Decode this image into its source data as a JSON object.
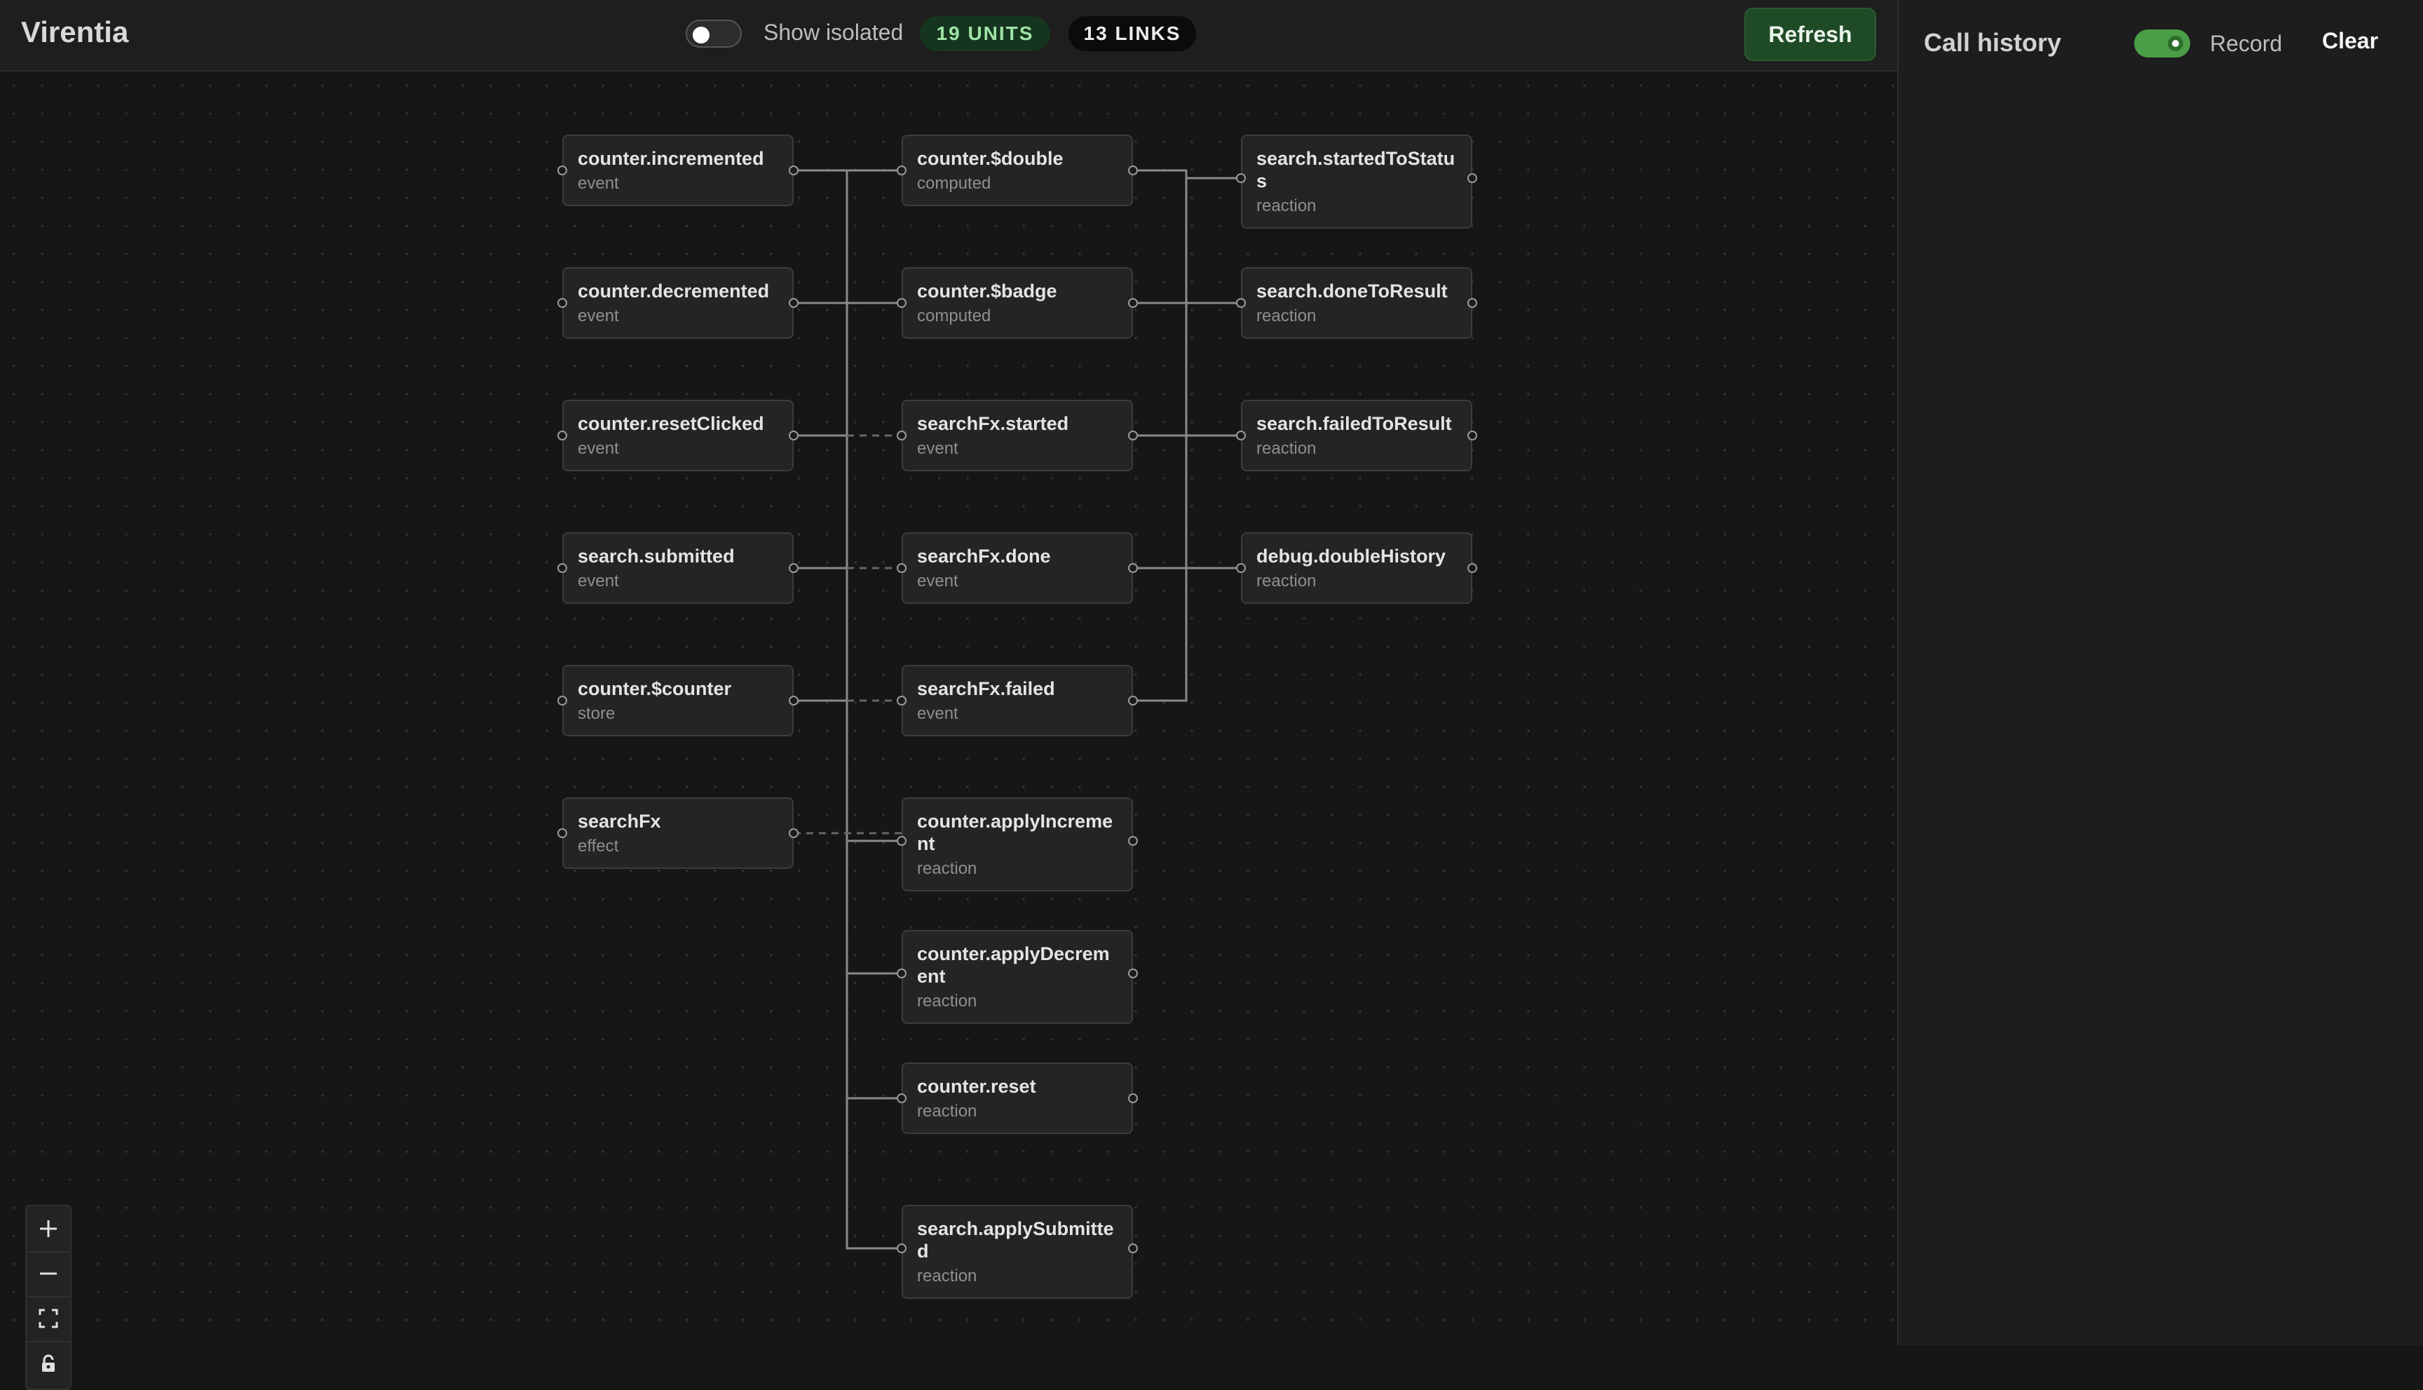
{
  "header": {
    "app_title": "Virentia",
    "show_isolated_label": "Show isolated",
    "show_isolated_on": false,
    "units_badge": "19 UNITS",
    "links_badge": "13 LINKS",
    "refresh_label": "Refresh"
  },
  "graph": {
    "nodes": [
      {
        "name": "counter.incremented",
        "type": "event"
      },
      {
        "name": "counter.decremented",
        "type": "event"
      },
      {
        "name": "counter.resetClicked",
        "type": "event"
      },
      {
        "name": "search.submitted",
        "type": "event"
      },
      {
        "name": "counter.$counter",
        "type": "store"
      },
      {
        "name": "searchFx",
        "type": "effect"
      },
      {
        "name": "counter.$double",
        "type": "computed"
      },
      {
        "name": "counter.$badge",
        "type": "computed"
      },
      {
        "name": "searchFx.started",
        "type": "event"
      },
      {
        "name": "searchFx.done",
        "type": "event"
      },
      {
        "name": "searchFx.failed",
        "type": "event"
      },
      {
        "name": "counter.applyIncrement",
        "type": "reaction"
      },
      {
        "name": "counter.applyDecrement",
        "type": "reaction"
      },
      {
        "name": "counter.reset",
        "type": "reaction"
      },
      {
        "name": "search.applySubmitted",
        "type": "reaction"
      },
      {
        "name": "search.startedToStatus",
        "type": "reaction"
      },
      {
        "name": "search.doneToResult",
        "type": "reaction"
      },
      {
        "name": "search.failedToResult",
        "type": "reaction"
      },
      {
        "name": "debug.doubleHistory",
        "type": "reaction"
      }
    ]
  },
  "call_history": {
    "title": "Call history",
    "record_label": "Record",
    "record_on": true,
    "clear_label": "Clear"
  },
  "colors": {
    "accent_green": "#4a9e47",
    "badge_units_bg": "#16351f",
    "refresh_bg": "#1f4a26",
    "canvas_bg": "#161616"
  },
  "icons": {
    "zoom_in": "plus-icon",
    "zoom_out": "minus-icon",
    "fit_view": "fit-view-icon",
    "lock": "lock-icon"
  }
}
